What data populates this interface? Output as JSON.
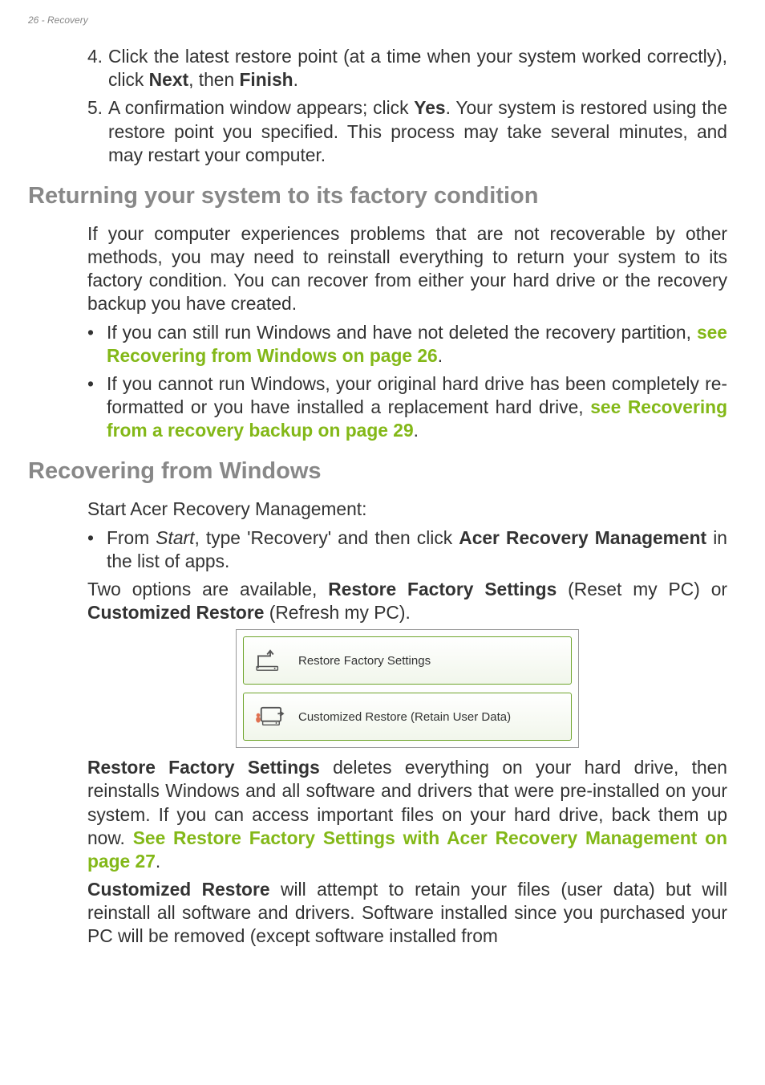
{
  "header": "26 - Recovery",
  "item4": {
    "num": "4.",
    "prefix": "Click the latest restore point (at a time when your system worked correctly), click ",
    "bold1": "Next",
    "mid": ", then ",
    "bold2": "Finish",
    "suffix": "."
  },
  "item5": {
    "num": "5.",
    "prefix": "A confirmation window appears; click ",
    "bold1": "Yes",
    "suffix": ". Your system is restored using the restore point you specified. This process may take several minutes, and may restart your computer."
  },
  "heading1": "Returning your system to its factory condition",
  "para1": "If your computer experiences problems that are not recoverable by other methods, you may need to reinstall everything to return your system to its factory condition. You can recover from either your hard drive or the recovery backup you have created.",
  "bullet1": {
    "prefix": "If you can still run Windows and have not deleted the recovery partition, ",
    "link": "see Recovering from Windows on page 26",
    "suffix": "."
  },
  "bullet2": {
    "prefix": "If you cannot run Windows, your original hard drive has been completely re-formatted or you have installed a replacement hard drive, ",
    "link": "see Recovering from a recovery backup on page 29",
    "suffix": "."
  },
  "heading2": "Recovering from Windows",
  "para2": "Start Acer Recovery Management:",
  "bullet3": {
    "pre": "From ",
    "italic": "Start",
    "mid": ", type 'Recovery' and then click ",
    "bold": "Acer Recovery Management",
    "suffix": " in the list of apps."
  },
  "para3a": "Two options are available, ",
  "para3b": "Restore Factory Settings",
  "para3c": " (Reset my PC) or ",
  "para3d": "Customized Restore",
  "para3e": " (Refresh my PC).",
  "screenshot": {
    "opt1": "Restore Factory Settings",
    "opt2": "Customized Restore (Retain User Data)"
  },
  "para4": {
    "bold1": "Restore Factory Settings",
    "p1": " deletes everything on your hard drive, then reinstalls Windows and all software and drivers that were pre-installed on your system. If you can access important files on your hard drive, back them up now. ",
    "link": "See Restore Factory Settings with Acer Recovery Management on page 27",
    "suffix": "."
  },
  "para5": {
    "bold1": "Customized Restore",
    "p1": " will attempt to retain your files (user data) but will reinstall all software and drivers. Software installed since you purchased your PC will be removed (except software installed from "
  }
}
